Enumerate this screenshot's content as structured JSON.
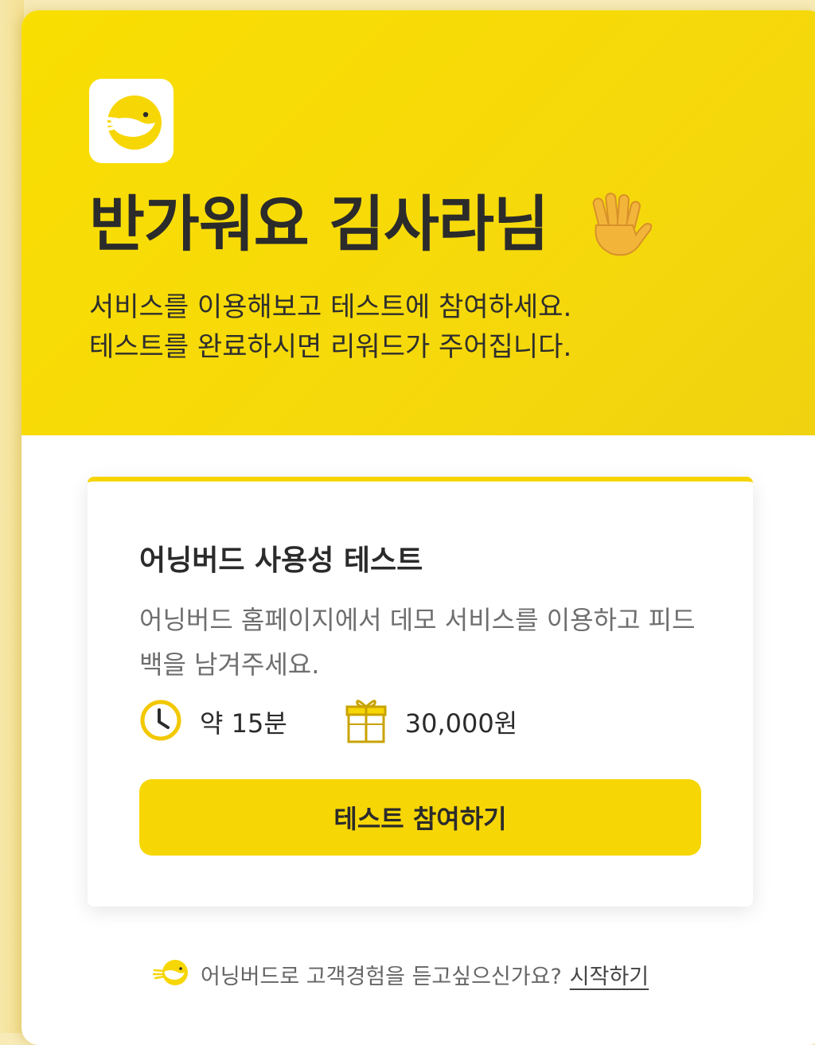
{
  "hero": {
    "logo_icon": "bird-logo-icon",
    "greeting": "반가워요 김사라님",
    "greeting_icon": "waving-hand-icon",
    "intro_line1": "서비스를 이용해보고 테스트에 참여하세요.",
    "intro_line2": "테스트를 완료하시면 리워드가 주어집니다."
  },
  "card": {
    "title": "어닝버드 사용성 테스트",
    "description": "어닝버드 홈페이지에서 데모 서비스를 이용하고 피드백을 남겨주세요.",
    "duration_icon": "clock-icon",
    "duration": "약 15분",
    "reward_icon": "gift-icon",
    "reward": "30,000원",
    "button_label": "테스트 참여하기"
  },
  "footer": {
    "icon": "bird-logo-icon",
    "text": "어닝버드로 고객경험을 듣고싶으신가요?",
    "link_label": "시작하기"
  },
  "colors": {
    "brand_yellow": "#f9de02",
    "button_yellow": "#f7d605",
    "text_dark": "#2b2b2b",
    "text_muted": "#6e6e6e"
  }
}
